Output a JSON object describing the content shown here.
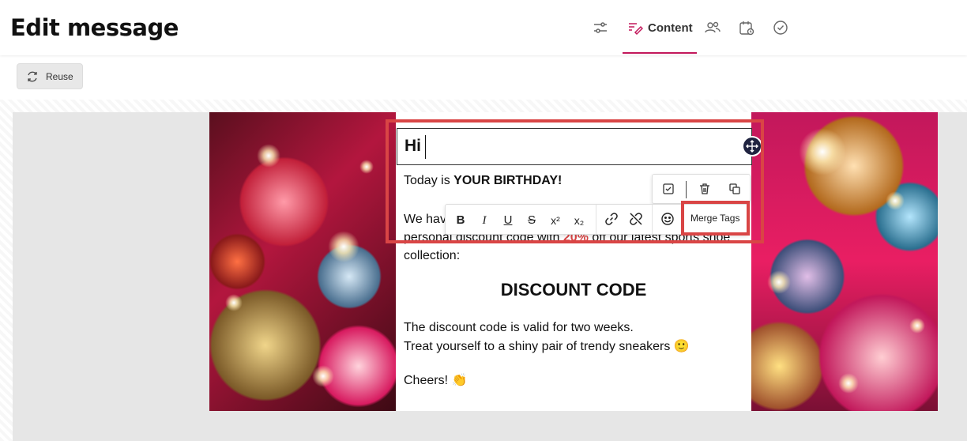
{
  "header": {
    "title": "Edit message",
    "tabs": [
      {
        "icon": "settings-sliders-icon"
      },
      {
        "icon": "content-pen-icon",
        "label": "Content",
        "active": true
      },
      {
        "icon": "audience-users-icon"
      },
      {
        "icon": "schedule-calendar-icon"
      },
      {
        "icon": "review-check-icon"
      }
    ],
    "accent_color": "#c2185b"
  },
  "toolbar": {
    "reuse_label": "Reuse",
    "reuse_icon": "reuse-cycle-icon"
  },
  "email": {
    "heading": "Hi",
    "greeting_prefix": "Today is ",
    "greeting_bold": "YOUR BIRTHDAY!",
    "offer_line1": "We hav",
    "offer_line2_prefix": "personal discount code with ",
    "offer_percent": "20%",
    "offer_line2_suffix": " off our latest sports shoe",
    "offer_line3": "collection:",
    "code_title": "DISCOUNT CODE",
    "validity_line": "The discount code is valid for two weeks.",
    "treat_line": "Treat yourself to a shiny pair of trendy sneakers 🙂",
    "signoff": "Cheers! 👏"
  },
  "block_tools": [
    {
      "icon": "select-check-icon"
    },
    {
      "icon": "delete-trash-icon"
    },
    {
      "icon": "duplicate-icon"
    }
  ],
  "format_bar": {
    "bold": "B",
    "italic": "I",
    "underline": "U",
    "strike": "S",
    "superscript": "x²",
    "subscript": "x₂",
    "merge_tags_label": "Merge Tags"
  },
  "highlight_color": "#d94545"
}
